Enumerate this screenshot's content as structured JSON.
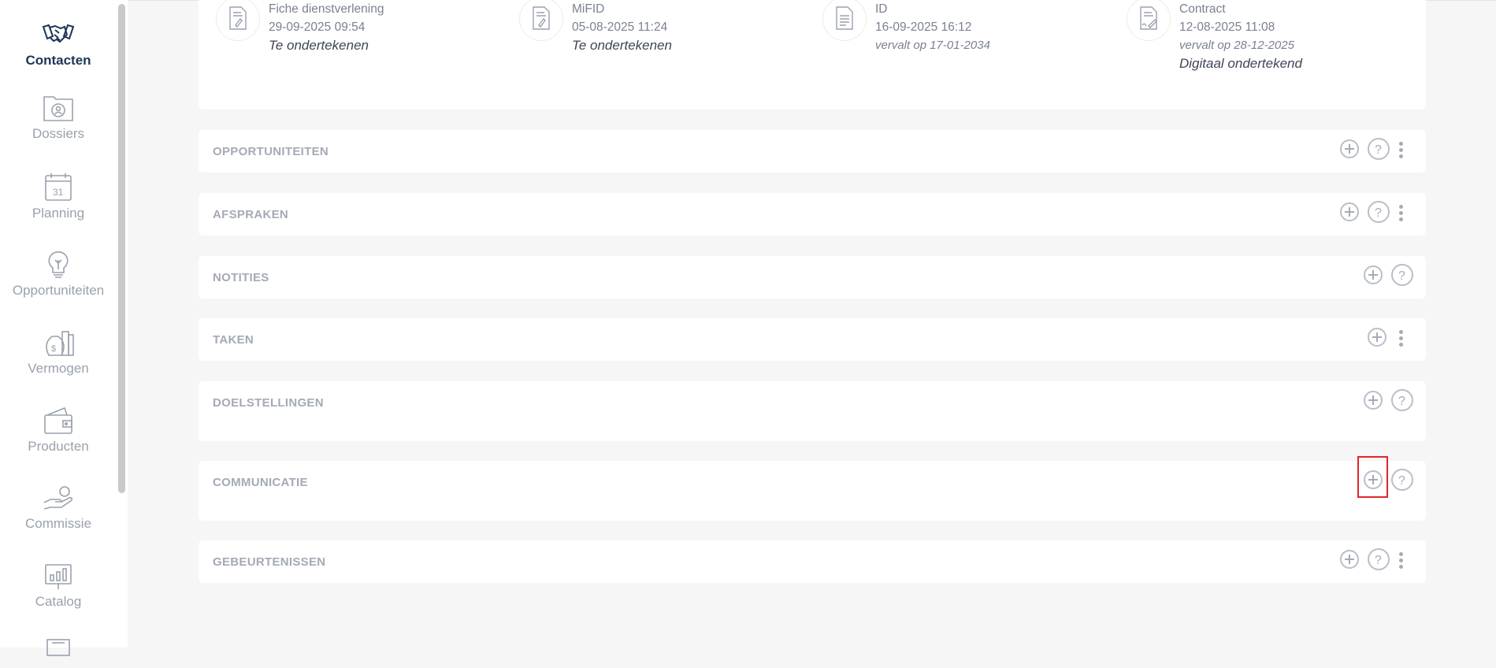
{
  "sidebar": {
    "items": [
      {
        "label": "Contacten",
        "icon": "handshake-icon",
        "active": true
      },
      {
        "label": "Dossiers",
        "icon": "folder-user-icon"
      },
      {
        "label": "Planning",
        "icon": "calendar-icon"
      },
      {
        "label": "Opportuniteiten",
        "icon": "lightbulb-icon"
      },
      {
        "label": "Vermogen",
        "icon": "money-bag-icon"
      },
      {
        "label": "Producten",
        "icon": "wallet-icon"
      },
      {
        "label": "Commissie",
        "icon": "hand-coin-icon"
      },
      {
        "label": "Catalog",
        "icon": "chart-board-icon"
      }
    ],
    "catalog_label": "Catalog"
  },
  "documents": [
    {
      "title": "Fiche dienstverlening",
      "date": "29-09-2025 09:54",
      "status": "Te ondertekenen",
      "icon": "signed-document-icon"
    },
    {
      "title": "MiFID",
      "date": "05-08-2025 11:24",
      "status": "Te ondertekenen",
      "icon": "signed-document-icon"
    },
    {
      "title": "ID",
      "date": "16-09-2025 16:12",
      "expires": "vervalt op 17-01-2034",
      "icon": "document-icon"
    },
    {
      "title": "Contract",
      "date": "12-08-2025 11:08",
      "expires": "vervalt op 28-12-2025",
      "status": "Digitaal ondertekend",
      "icon": "contract-icon"
    }
  ],
  "sections": [
    {
      "title": "OPPORTUNITEITEN",
      "actions": [
        "add",
        "help",
        "more"
      ]
    },
    {
      "title": "AFSPRAKEN",
      "actions": [
        "add",
        "help",
        "more"
      ]
    },
    {
      "title": "NOTITIES",
      "actions": [
        "add",
        "help"
      ]
    },
    {
      "title": "TAKEN",
      "actions": [
        "add",
        "more"
      ]
    },
    {
      "title": "DOELSTELLINGEN",
      "actions": [
        "add",
        "help"
      ]
    },
    {
      "title": "COMMUNICATIE",
      "actions": [
        "add",
        "help"
      ]
    },
    {
      "title": "GEBEURTENISSEN",
      "actions": [
        "add",
        "help",
        "more"
      ]
    }
  ],
  "colors": {
    "highlight": "#e0262b",
    "active_nav": "#1d3557"
  }
}
